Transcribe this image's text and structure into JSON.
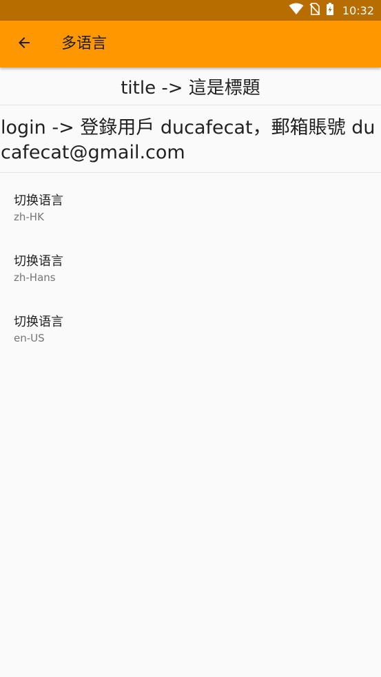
{
  "status_bar": {
    "time": "10:32",
    "icons": [
      "wifi-icon",
      "no-sim-icon",
      "battery-charging-icon"
    ]
  },
  "app_bar": {
    "back_icon": "arrow-back-icon",
    "title": "多语言"
  },
  "main": {
    "title_text": "title -> 這是標題",
    "login_text": "login -> 登錄用戶 ducafecat，郵箱賬號 ducafecat@gmail.com",
    "items": [
      {
        "title": "切换语言",
        "subtitle": "zh-HK"
      },
      {
        "title": "切换语言",
        "subtitle": "zh-Hans"
      },
      {
        "title": "切换语言",
        "subtitle": "en-US"
      }
    ]
  },
  "colors": {
    "status_bar": "#b76d00",
    "app_bar": "#ff9800",
    "background": "#fafafa"
  }
}
